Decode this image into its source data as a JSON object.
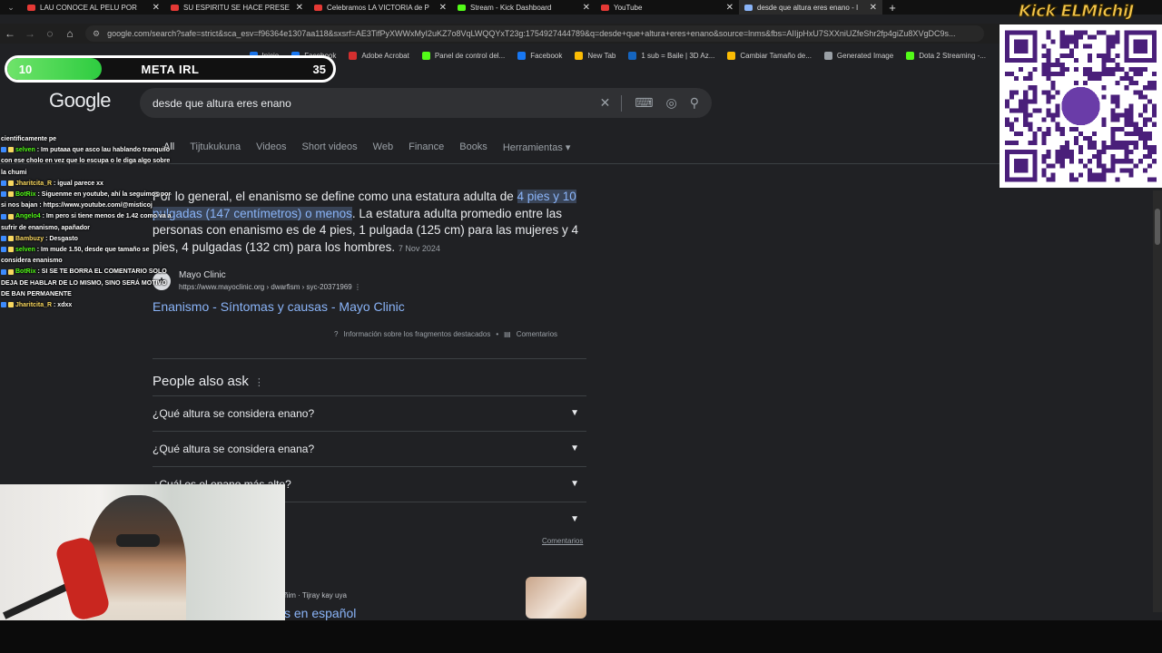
{
  "browser": {
    "tabs": [
      {
        "title": "LAU CONOCE AL PELU POR",
        "fav": "#e53935"
      },
      {
        "title": "SU ESPIRITU SE HACE PRESE",
        "fav": "#e53935"
      },
      {
        "title": "Celebramos LA VICTORIA de P",
        "fav": "#e53935"
      },
      {
        "title": "Stream - Kick Dashboard",
        "fav": "#53fc18"
      },
      {
        "title": "YouTube",
        "fav": "#e53935"
      },
      {
        "title": "desde que altura eres enano - I",
        "fav": "#8ab4f8"
      }
    ],
    "address": "google.com/search?safe=strict&sca_esv=f96364e1307aa118&sxsrf=AE3TifPyXWWxMyI2uKZ7o8VqLWQQYxT23g:1754927444789&q=desde+que+altura+eres+enano&source=lnms&fbs=AIIjpHxU7SXXniUZfeShr2fp4giZu8XVgDC9s...",
    "address_host": "google.com",
    "bookmarks": [
      {
        "label": "Inicio",
        "color": "#1a73e8"
      },
      {
        "label": "Facebook",
        "color": "#1877f2"
      },
      {
        "label": "Adobe Acrobat",
        "color": "#d32f2f"
      },
      {
        "label": "Panel de control del...",
        "color": "#53fc18"
      },
      {
        "label": "Facebook",
        "color": "#1877f2"
      },
      {
        "label": "New Tab",
        "color": "#fbbc04"
      },
      {
        "label": "1 sub = Baile | 3D Az...",
        "color": "#1565c0"
      },
      {
        "label": "Cambiar Tamaño de...",
        "color": "#fbbc04"
      },
      {
        "label": "Generated Image",
        "color": "#9aa0a6"
      },
      {
        "label": "Dota 2 Streaming -...",
        "color": "#53fc18"
      }
    ]
  },
  "google": {
    "logo": "Google",
    "query": "desde que altura eres enano",
    "tabs": [
      "All",
      "Tijtukukuna",
      "Videos",
      "Short videos",
      "Web",
      "Finance",
      "Books",
      "Herramientas ▾"
    ],
    "snippet_before": "Por lo general, el enanismo se define como una estatura adulta de ",
    "snippet_highlight": "4 pies y 10 pulgadas (147 centímetros) o menos",
    "snippet_after": ". La estatura adulta promedio entre las personas con enanismo es de 4 pies, 1 pulgada (125 cm) para las mujeres y 4 pies, 4 pulgadas (132 cm) para los hombres.",
    "snippet_date": "7 Nov 2024",
    "source_name": "Mayo Clinic",
    "source_url": "https://www.mayoclinic.org › dwarfism › syc-20371969",
    "result_title": "Enanismo - Síntomas y causas - Mayo Clinic",
    "featured_info": "Información sobre los fragmentos destacados",
    "featured_feedback": "Comentarios",
    "paa_title": "People also ask",
    "paa": [
      "¿Qué altura se considera enano?",
      "¿Qué altura se considera enana?",
      "¿Cuál es el enano más alto?",
      "diano?"
    ],
    "paa_feedback": "Comentarios",
    "result2_url": "ñim · Tijray kay uya",
    "result2_title": "s en español"
  },
  "overlay": {
    "meta_current": "10",
    "meta_label": "META IRL",
    "meta_goal": "35",
    "meta_progress": 0.29,
    "kick_banner": "Kick ELMichiJ",
    "chat": [
      {
        "user": "",
        "text": "cientificamente pe",
        "color": "#ffffff"
      },
      {
        "user": "selven",
        "text": ": Im putaaa que asco lau hablando tranquilo con ese cholo en vez que lo escupa o le diga algo sobre la chumi",
        "color": "#53fc18"
      },
      {
        "user": "Jharitcita_R",
        "text": ": igual parece xx",
        "color": "#f9d85f"
      },
      {
        "user": "BotRix",
        "text": ": Siguenme en youtube, ahí la seguimos por si nos bajan : https://www.youtube.com/@misticoj",
        "color": "#53fc18"
      },
      {
        "user": "Angelo4",
        "text": ": Im pero si tiene menos de 1.42 como va a sufrir de enanismo, apañador",
        "color": "#53fc18"
      },
      {
        "user": "Bambuzy",
        "text": ": Desgasto",
        "color": "#f9d85f"
      },
      {
        "user": "selven",
        "text": ": Im mude 1.50, desde que tamaño se considera enanismo",
        "color": "#53fc18"
      },
      {
        "user": "BotRix",
        "text": ": SI SE TE BORRA EL COMENTARIO SOLO DEJA DE HABLAR DE LO MISMO, SINO SERÁ MOTIVO DE BAN PERMANENTE",
        "color": "#53fc18"
      },
      {
        "user": "Jharitcita_R",
        "text": ": xdxx",
        "color": "#f9d85f"
      }
    ]
  }
}
